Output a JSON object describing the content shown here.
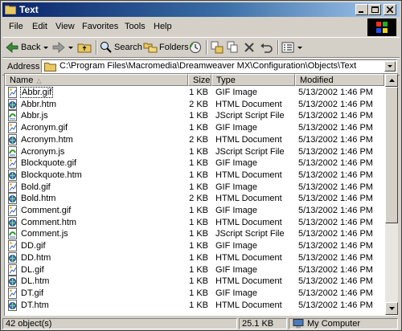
{
  "window": {
    "title": "Text"
  },
  "menubar": {
    "items": [
      "File",
      "Edit",
      "View",
      "Favorites",
      "Tools",
      "Help"
    ]
  },
  "toolbar": {
    "back": "Back",
    "search": "Search",
    "folders": "Folders"
  },
  "address": {
    "label": "Address",
    "value": "C:\\Program Files\\Macromedia\\Dreamweaver MX\\Configuration\\Objects\\Text"
  },
  "columns": {
    "name": "Name",
    "size": "Size",
    "type": "Type",
    "modified": "Modified"
  },
  "files": [
    {
      "name": "Abbr.gif",
      "size": "1 KB",
      "type": "GIF Image",
      "modified": "5/13/2002 1:46 PM",
      "icon": "gif-icon"
    },
    {
      "name": "Abbr.htm",
      "size": "2 KB",
      "type": "HTML Document",
      "modified": "5/13/2002 1:46 PM",
      "icon": "html-icon"
    },
    {
      "name": "Abbr.js",
      "size": "1 KB",
      "type": "JScript Script File",
      "modified": "5/13/2002 1:46 PM",
      "icon": "js-icon"
    },
    {
      "name": "Acronym.gif",
      "size": "1 KB",
      "type": "GIF Image",
      "modified": "5/13/2002 1:46 PM",
      "icon": "gif-icon"
    },
    {
      "name": "Acronym.htm",
      "size": "2 KB",
      "type": "HTML Document",
      "modified": "5/13/2002 1:46 PM",
      "icon": "html-icon"
    },
    {
      "name": "Acronym.js",
      "size": "1 KB",
      "type": "JScript Script File",
      "modified": "5/13/2002 1:46 PM",
      "icon": "js-icon"
    },
    {
      "name": "Blockquote.gif",
      "size": "1 KB",
      "type": "GIF Image",
      "modified": "5/13/2002 1:46 PM",
      "icon": "gif-icon"
    },
    {
      "name": "Blockquote.htm",
      "size": "1 KB",
      "type": "HTML Document",
      "modified": "5/13/2002 1:46 PM",
      "icon": "html-icon"
    },
    {
      "name": "Bold.gif",
      "size": "1 KB",
      "type": "GIF Image",
      "modified": "5/13/2002 1:46 PM",
      "icon": "gif-icon"
    },
    {
      "name": "Bold.htm",
      "size": "2 KB",
      "type": "HTML Document",
      "modified": "5/13/2002 1:46 PM",
      "icon": "html-icon"
    },
    {
      "name": "Comment.gif",
      "size": "1 KB",
      "type": "GIF Image",
      "modified": "5/13/2002 1:46 PM",
      "icon": "gif-icon"
    },
    {
      "name": "Comment.htm",
      "size": "1 KB",
      "type": "HTML Document",
      "modified": "5/13/2002 1:46 PM",
      "icon": "html-icon"
    },
    {
      "name": "Comment.js",
      "size": "1 KB",
      "type": "JScript Script File",
      "modified": "5/13/2002 1:46 PM",
      "icon": "js-icon"
    },
    {
      "name": "DD.gif",
      "size": "1 KB",
      "type": "GIF Image",
      "modified": "5/13/2002 1:46 PM",
      "icon": "gif-icon"
    },
    {
      "name": "DD.htm",
      "size": "1 KB",
      "type": "HTML Document",
      "modified": "5/13/2002 1:46 PM",
      "icon": "html-icon"
    },
    {
      "name": "DL.gif",
      "size": "1 KB",
      "type": "GIF Image",
      "modified": "5/13/2002 1:46 PM",
      "icon": "gif-icon"
    },
    {
      "name": "DL.htm",
      "size": "1 KB",
      "type": "HTML Document",
      "modified": "5/13/2002 1:46 PM",
      "icon": "html-icon"
    },
    {
      "name": "DT.gif",
      "size": "1 KB",
      "type": "GIF Image",
      "modified": "5/13/2002 1:46 PM",
      "icon": "gif-icon"
    },
    {
      "name": "DT.htm",
      "size": "1 KB",
      "type": "HTML Document",
      "modified": "5/13/2002 1:46 PM",
      "icon": "html-icon"
    }
  ],
  "status": {
    "objects": "42 object(s)",
    "size": "25.1 KB",
    "zone": "My Computer"
  }
}
